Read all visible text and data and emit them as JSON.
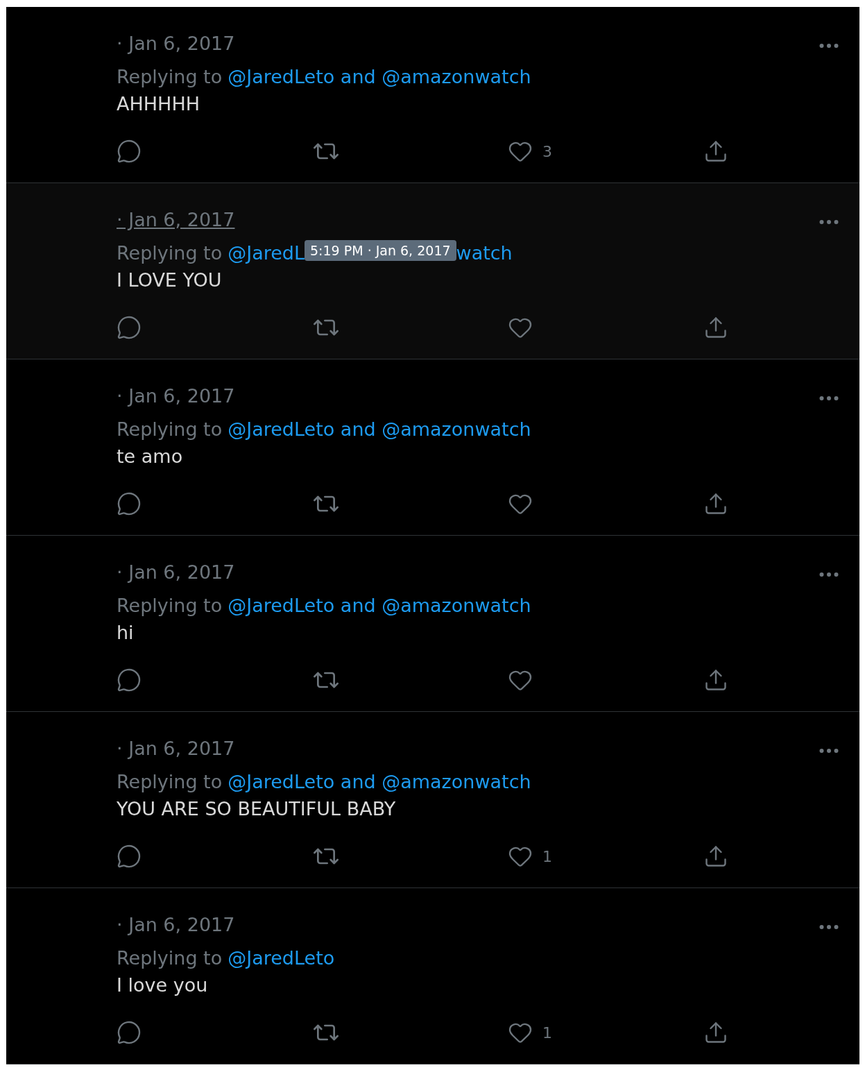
{
  "tweets": [
    {
      "date": "· Jan 6, 2017",
      "hovered": false,
      "replying_label": "Replying to",
      "mentions": "@JaredLeto and @amazonwatch",
      "text": "AHHHHH",
      "likes": "3"
    },
    {
      "date": "· Jan 6, 2017",
      "hovered": true,
      "replying_label": "Replying to",
      "mentions": "@JaredL",
      "tooltip": "5:19 PM · Jan 6, 2017",
      "mentions_after": "watch",
      "text": "I LOVE YOU"
    },
    {
      "date": "· Jan 6, 2017",
      "hovered": false,
      "replying_label": "Replying to",
      "mentions": "@JaredLeto and @amazonwatch",
      "text": "te amo"
    },
    {
      "date": "· Jan 6, 2017",
      "hovered": false,
      "replying_label": "Replying to",
      "mentions": "@JaredLeto and @amazonwatch",
      "text": "hi"
    },
    {
      "date": "· Jan 6, 2017",
      "hovered": false,
      "replying_label": "Replying to",
      "mentions": "@JaredLeto and @amazonwatch",
      "text": "YOU ARE SO BEAUTIFUL BABY",
      "likes": "1"
    },
    {
      "date": "· Jan 6, 2017",
      "hovered": false,
      "replying_label": "Replying to",
      "mentions": "@JaredLeto",
      "text": "I love you",
      "likes": "1"
    }
  ]
}
